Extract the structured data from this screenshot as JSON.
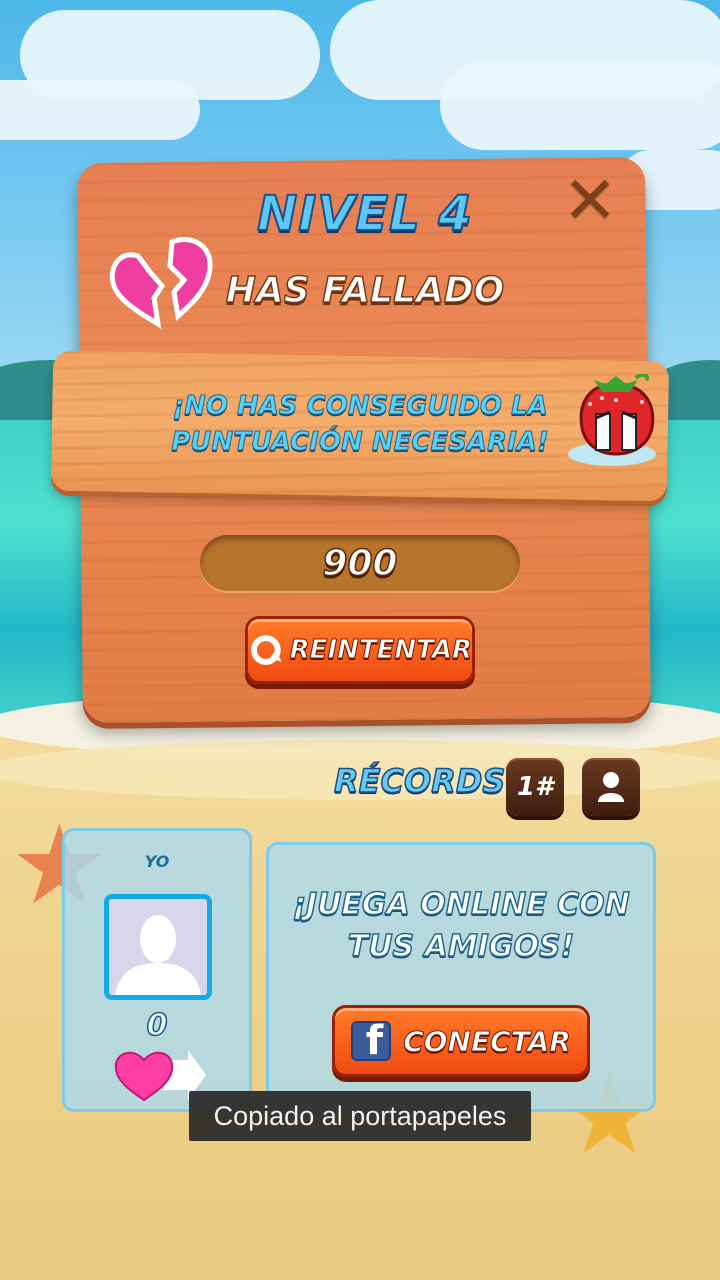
{
  "dialog": {
    "level_title": "NIVEL 4",
    "result_title": "HAS FALLADO",
    "message_line1": "¡NO HAS CONSEGUIDO LA",
    "message_line2": "PUNTUACIÓN NECESARIA!",
    "score": "900",
    "retry_label": "REINTENTAR",
    "close_icon": "close-icon"
  },
  "records": {
    "label": "RÉCORDS:",
    "rank_button": "1#",
    "profile_icon": "person-icon"
  },
  "player_panel": {
    "label": "YO",
    "score": "0",
    "avatar_icon": "avatar-silhouette-icon",
    "heart_icon": "heart-arrow-icon"
  },
  "social_panel": {
    "message_line1": "¡JUEGA ONLINE CON",
    "message_line2": "TUS AMIGOS!",
    "connect_label": "CONECTAR",
    "facebook_icon": "facebook-icon"
  },
  "toast": {
    "text": "Copiado al portapapeles"
  },
  "colors": {
    "title_blue": "#5ec8f3",
    "wood": "#e77f52",
    "button_orange": "#f04a10",
    "panel_blue": "#abdaee"
  }
}
